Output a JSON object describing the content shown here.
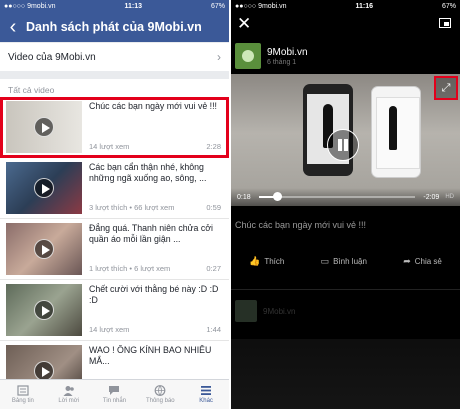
{
  "left": {
    "status": {
      "carrier": "●●○○○ 9mobi.vn",
      "time": "11:13",
      "battery": "67%"
    },
    "header": {
      "back_icon": "chevron-left",
      "title": "Danh sách phát của 9Mobi.vn"
    },
    "section_link": "Video của 9Mobi.vn",
    "all_label": "Tất cả video",
    "videos": [
      {
        "title": "Chúc các bạn ngày mới vui vẻ !!!",
        "meta": "14 lượt xem",
        "duration": "2:28",
        "selected": true
      },
      {
        "title": "Các bạn cẩn thận nhé, không những ngã xuống ao, sông, ...",
        "meta": "3 lượt thích • 66 lượt xem",
        "duration": "0:59"
      },
      {
        "title": "Đẳng quá. Thanh niên chửa cởi quần áo mỗi lần giận ...",
        "meta": "1 lượt thích • 6 lượt xem",
        "duration": "0:27"
      },
      {
        "title": "Chết cười với thằng bé này :D :D :D",
        "meta": "14 lượt xem",
        "duration": "1:44"
      },
      {
        "title": "WAO ! ÔNG KÍNH BAO NHIÊU MẮ...",
        "meta": "",
        "duration": ""
      }
    ],
    "tabs": [
      {
        "label": "Bảng tin",
        "icon": "news-feed-icon"
      },
      {
        "label": "Lời mời",
        "icon": "friend-requests-icon"
      },
      {
        "label": "Tin nhắn",
        "icon": "messages-icon"
      },
      {
        "label": "Thông báo",
        "icon": "notifications-icon"
      },
      {
        "label": "Khác",
        "icon": "more-menu-icon",
        "active": true
      }
    ]
  },
  "right": {
    "status": {
      "carrier": "●●○○○ 9mobi.vn",
      "time": "11:16",
      "battery": "67%"
    },
    "page_name": "9Mobi.vn",
    "date": "6 tháng 1",
    "player": {
      "elapsed": "0:18",
      "remaining": "-2:09",
      "hd": "HD",
      "progress": 0.12
    },
    "caption": "Chúc các bạn ngày mới vui vẻ !!!",
    "actions": [
      {
        "label": "Thích",
        "icon": "like-icon"
      },
      {
        "label": "Bình luận",
        "icon": "comment-icon"
      },
      {
        "label": "Chia sẻ",
        "icon": "share-icon"
      }
    ],
    "share_name": "9Mobi.vn"
  },
  "colors": {
    "facebook_blue": "#3b5998",
    "highlight_red": "#e3001b"
  }
}
